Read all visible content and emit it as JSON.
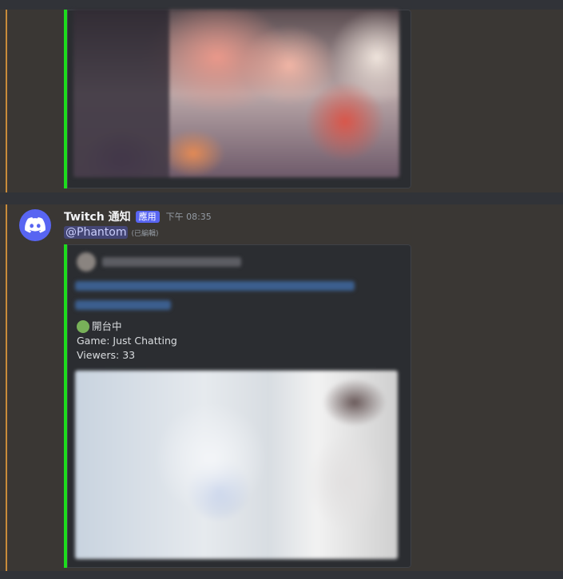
{
  "message": {
    "author": "Twitch 通知",
    "app_badge": "應用",
    "timestamp": "下午 08:35",
    "mention": "@Phantom",
    "edited_label": "(已編輯)"
  },
  "embed": {
    "status": "開台中",
    "game_line": "Game: Just Chatting",
    "viewers_line": "Viewers: 33"
  },
  "colors": {
    "embed_accent": "#1ddc1d",
    "blurple": "#5865f2",
    "status_circle": "#78b159"
  },
  "icons": {
    "avatar": "discord-logo-icon",
    "status": "green-circle-icon"
  }
}
